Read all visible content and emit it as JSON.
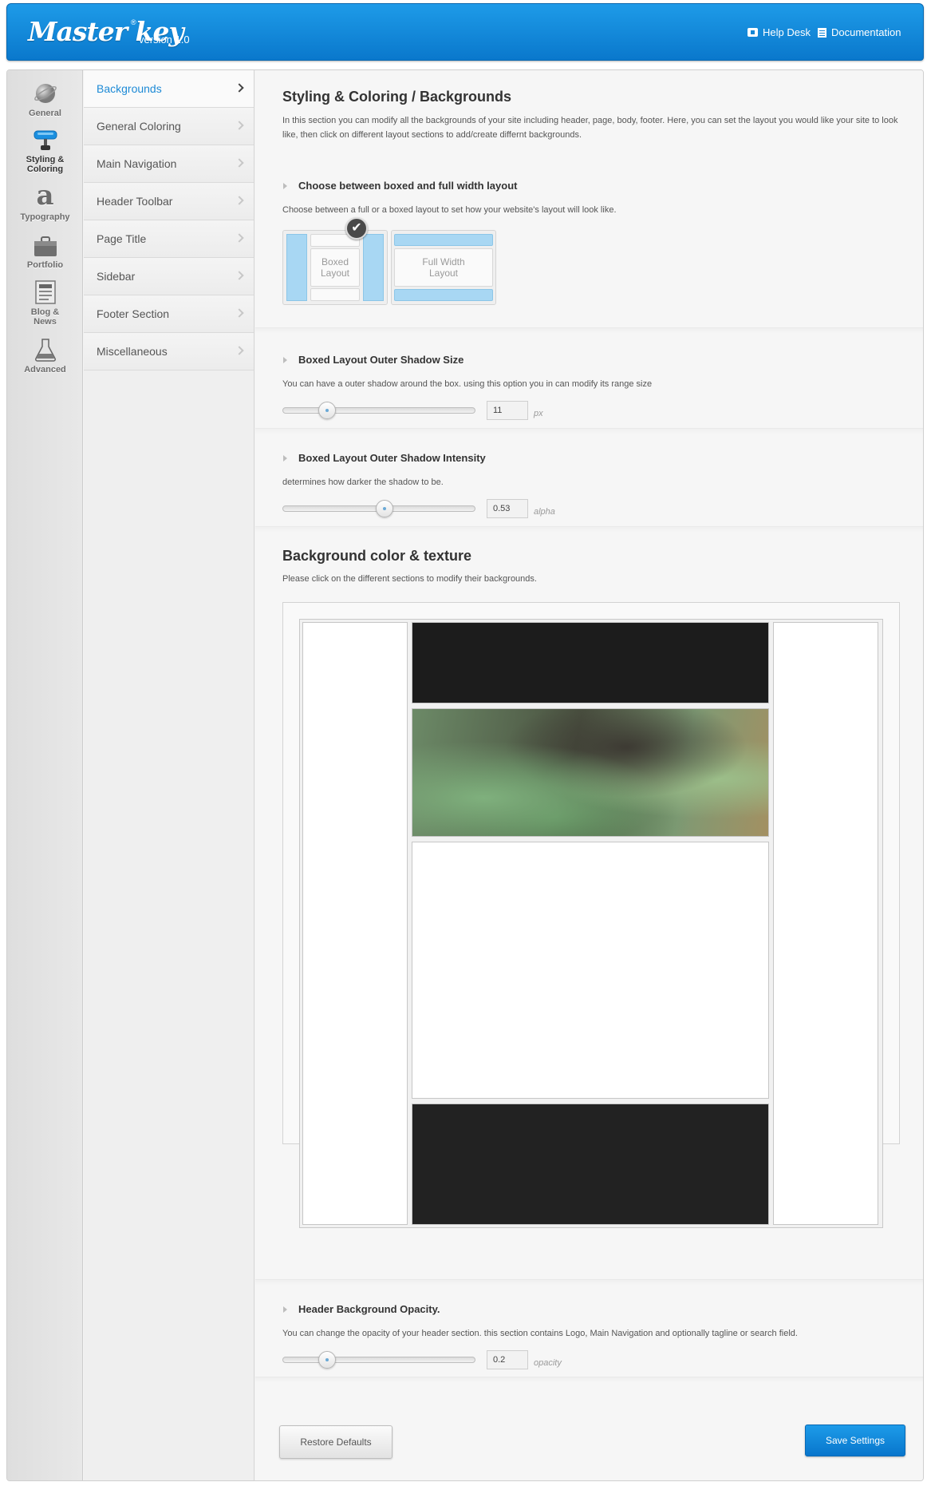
{
  "header": {
    "logo_text": "Master key",
    "logo_mark": "®",
    "version": "version 1.0",
    "help_desk": "Help Desk",
    "documentation": "Documentation"
  },
  "icon_nav": {
    "active": "styling",
    "items": [
      {
        "id": "general",
        "label": "General",
        "icon": "globe-icon"
      },
      {
        "id": "styling",
        "label": "Styling &\nColoring",
        "icon": "paint-roller-icon"
      },
      {
        "id": "typography",
        "label": "Typography",
        "icon": "letter-a-icon"
      },
      {
        "id": "portfolio",
        "label": "Portfolio",
        "icon": "briefcase-icon"
      },
      {
        "id": "blog",
        "label": "Blog &\nNews",
        "icon": "newspaper-icon"
      },
      {
        "id": "advanced",
        "label": "Advanced",
        "icon": "flask-icon"
      }
    ]
  },
  "sub_nav": {
    "active_index": 0,
    "items": [
      "Backgrounds",
      "General Coloring",
      "Main Navigation",
      "Header Toolbar",
      "Page Title",
      "Sidebar",
      "Footer Section",
      "Miscellaneous"
    ]
  },
  "intro": {
    "title": "Styling & Coloring / Backgrounds",
    "text": "In this section you can modify all the backgrounds of your site including header, page, body, footer. Here, you can set the layout you would like your site to look like, then click on different layout sections to add/create differnt backgrounds."
  },
  "layout_choice": {
    "title": "Choose between boxed and full width layout",
    "desc": "Choose between a full or a boxed layout to set how your website's layout will look like.",
    "selected": "boxed",
    "boxed_label": "Boxed\nLayout",
    "full_label": "Full Width\nLayout"
  },
  "shadow_size": {
    "title": "Boxed Layout Outer Shadow Size",
    "desc": "You can have a outer shadow around the box. using this option you in can modify its range size",
    "value": "11",
    "unit": "px",
    "slider_fraction": 0.2
  },
  "shadow_intensity": {
    "title": "Boxed Layout Outer Shadow Intensity",
    "desc": "determines how darker the shadow to be.",
    "value": "0.53",
    "unit": "alpha",
    "slider_fraction": 0.53
  },
  "bg_section": {
    "title": "Background color & texture",
    "desc": "Please click on the different sections to modify their backgrounds.",
    "colors": {
      "header": "#1c1c1c",
      "page_title": "texture-blur-green",
      "page": "#ffffff",
      "footer": "#222222",
      "side": "#ffffff"
    }
  },
  "header_opacity": {
    "title": "Header Background Opacity.",
    "desc": "You can change the opacity of your header section. this section contains Logo, Main Navigation and optionally tagline or search field.",
    "value": "0.2",
    "unit": "opacity",
    "slider_fraction": 0.2
  },
  "actions": {
    "restore": "Restore Defaults",
    "save": "Save Settings"
  },
  "colors": {
    "accent": "#1d8ad6",
    "header_blue": "#0a78cc"
  }
}
